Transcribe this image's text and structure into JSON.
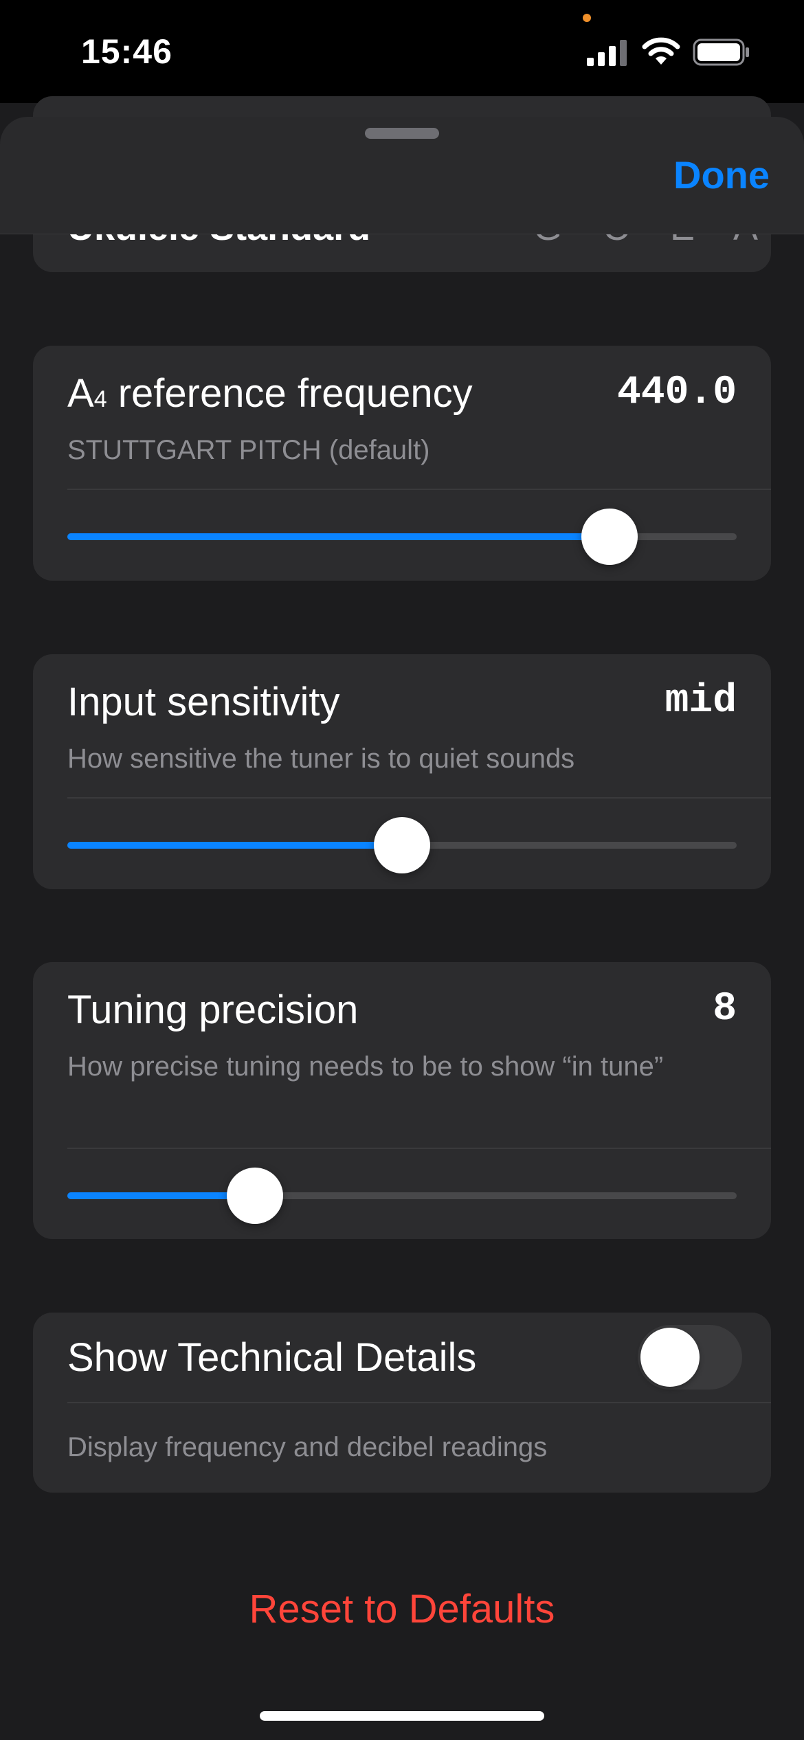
{
  "status_bar": {
    "time": "15:46"
  },
  "partial_row": {
    "label": "Ukulele Standard",
    "value": "G C E A"
  },
  "header": {
    "done_label": "Done"
  },
  "reference_frequency": {
    "title_main": "A",
    "title_sub": "4",
    "title_rest": " reference frequency",
    "value": "440.0",
    "subtitle": "STUTTGART PITCH (default)",
    "slider_fraction": 0.81
  },
  "input_sensitivity": {
    "title": "Input sensitivity",
    "value": "mid",
    "subtitle": "How sensitive the tuner is to quiet sounds",
    "slider_fraction": 0.5
  },
  "tuning_precision": {
    "title": "Tuning precision",
    "value": "8",
    "subtitle": "How precise tuning needs to be to show “in tune”",
    "slider_fraction": 0.28
  },
  "technical_details": {
    "title": "Show Technical Details",
    "enabled": false,
    "subtitle": "Display frequency and decibel readings"
  },
  "reset_label": "Reset to Defaults",
  "colors": {
    "accent": "#0a84ff",
    "destructive": "#ff453a",
    "card": "#2c2c2e",
    "background": "#1c1c1e"
  }
}
